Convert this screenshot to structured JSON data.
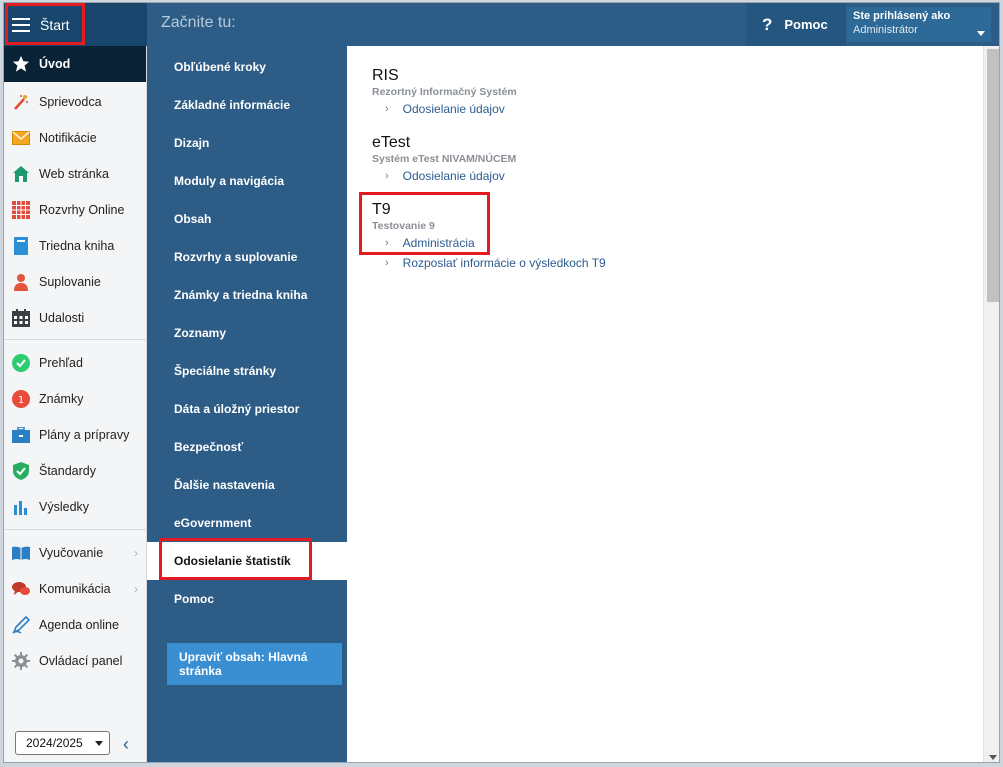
{
  "topbar": {
    "start_label": "Štart",
    "title": "Začnite tu:",
    "help_label": "Pomoc",
    "user_line1": "Ste prihlásený ako",
    "user_line2": "Administrátor"
  },
  "sidebar": {
    "items": [
      {
        "label": "Úvod",
        "icon": "star-icon"
      },
      {
        "label": "Sprievodca",
        "icon": "magic-wand-icon"
      },
      {
        "label": "Notifikácie",
        "icon": "envelope-icon"
      },
      {
        "label": "Web stránka",
        "icon": "house-icon"
      },
      {
        "label": "Rozvrhy Online",
        "icon": "timetable-grid-icon"
      },
      {
        "label": "Triedna kniha",
        "icon": "book-icon"
      },
      {
        "label": "Suplovanie",
        "icon": "person-icon"
      },
      {
        "label": "Udalosti",
        "icon": "calendar-icon"
      },
      {
        "label": "Prehľad",
        "icon": "check-circle-icon"
      },
      {
        "label": "Známky",
        "icon": "grade-circle-icon"
      },
      {
        "label": "Plány a prípravy",
        "icon": "briefcase-icon"
      },
      {
        "label": "Štandardy",
        "icon": "shield-check-icon"
      },
      {
        "label": "Výsledky",
        "icon": "bar-chart-icon"
      },
      {
        "label": "Vyučovanie",
        "icon": "open-book-icon"
      },
      {
        "label": "Komunikácia",
        "icon": "chat-bubbles-icon"
      },
      {
        "label": "Agenda online",
        "icon": "pen-icon"
      },
      {
        "label": "Ovládací panel",
        "icon": "gear-icon"
      }
    ],
    "year": "2024/2025"
  },
  "nav": {
    "items": [
      "Obľúbené kroky",
      "Základné informácie",
      "Dizajn",
      "Moduly a navigácia",
      "Obsah",
      "Rozvrhy a suplovanie",
      "Známky a triedna kniha",
      "Zoznamy",
      "Špeciálne stránky",
      "Dáta a úložný priestor",
      "Bezpečnosť",
      "Ďalšie nastavenia",
      "eGovernment",
      "Odosielanie štatistík",
      "Pomoc"
    ],
    "edit_button": "Upraviť obsah: Hlavná stránka"
  },
  "content": {
    "sections": [
      {
        "title": "RIS",
        "subtitle": "Rezortný Informačný Systém",
        "links": [
          "Odosielanie údajov"
        ]
      },
      {
        "title": "eTest",
        "subtitle": "Systém eTest NIVAM/NÚCEM",
        "links": [
          "Odosielanie údajov"
        ]
      },
      {
        "title": "T9",
        "subtitle": "Testovanie 9",
        "links": [
          "Administrácia",
          "Rozposlať informácie o výsledkoch T9"
        ]
      }
    ]
  },
  "colors": {
    "nav_bg": "#2d5d86",
    "start_bg": "#17456b",
    "highlight": "#e31b23",
    "link": "#2c5b8f"
  }
}
